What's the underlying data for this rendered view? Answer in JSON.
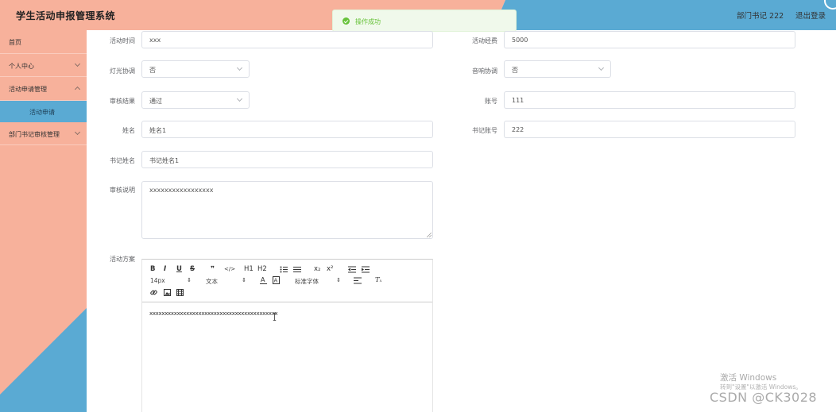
{
  "app": {
    "title": "学生活动申报管理系统",
    "user_label": "部门书记 222",
    "logout_label": "退出登录"
  },
  "toast": {
    "message": "操作成功",
    "type": "success"
  },
  "sidebar": {
    "items": [
      {
        "label": "首页",
        "expandable": false
      },
      {
        "label": "个人中心",
        "expandable": true
      },
      {
        "label": "活动申请管理",
        "expandable": true,
        "expanded": true
      },
      {
        "label": "部门书记审核管理",
        "expandable": true
      }
    ],
    "sub_items": [
      {
        "label": "活动申请",
        "active": true
      }
    ]
  },
  "form": {
    "activity_time": {
      "label": "活动时间",
      "value": "xxx"
    },
    "activity_budget": {
      "label": "活动经费",
      "value": "5000"
    },
    "lighting": {
      "label": "灯光协调",
      "value": "否"
    },
    "sound": {
      "label": "音响协调",
      "value": "否"
    },
    "review_result": {
      "label": "审核结果",
      "value": "通过"
    },
    "account": {
      "label": "账号",
      "value": "111"
    },
    "name": {
      "label": "姓名",
      "value": "姓名1"
    },
    "secretary_account": {
      "label": "书记账号",
      "value": "222"
    },
    "secretary_name": {
      "label": "书记姓名",
      "value": "书记姓名1"
    },
    "review_note": {
      "label": "审核说明",
      "value": "xxxxxxxxxxxxxxxxx"
    },
    "plan": {
      "label": "活动方案",
      "value": "xxxxxxxxxxxxxxxxxxxxxxxxxxxxxxxxxxxxxxxxxx"
    }
  },
  "editor": {
    "font_size": "14px",
    "text_style": "文本",
    "font_family": "标准字体",
    "tools": [
      "B",
      "I",
      "U",
      "S",
      "❞",
      "</>",
      "H1",
      "H2",
      "ol",
      "ul",
      "x₂",
      "x²",
      "outdent",
      "indent",
      "color",
      "background",
      "align",
      "clean",
      "link",
      "image",
      "video"
    ]
  },
  "watermark": {
    "activate_title": "激活 Windows",
    "activate_hint": "转到\"设置\"以激活 Windows。",
    "csdn": "CSDN @CK3028"
  },
  "colors": {
    "salmon": "#f7b19b",
    "blue": "#5aaad3",
    "success": "#67c23a"
  }
}
